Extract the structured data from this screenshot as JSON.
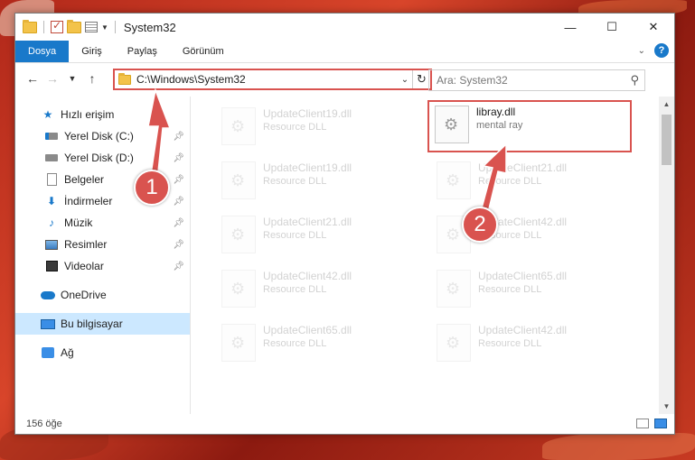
{
  "window": {
    "title": "System32"
  },
  "ribbon": {
    "tabs": [
      "Dosya",
      "Giriş",
      "Paylaş",
      "Görünüm"
    ]
  },
  "address": {
    "path": "C:\\Windows\\System32"
  },
  "search": {
    "placeholder": "Ara: System32"
  },
  "nav": {
    "items": [
      {
        "label": "Hızlı erişim",
        "icon": "star-icon"
      },
      {
        "label": "Yerel Disk (C:)",
        "icon": "drive-icon"
      },
      {
        "label": "Yerel Disk (D:)",
        "icon": "drive-icon"
      },
      {
        "label": "Belgeler",
        "icon": "document-icon"
      },
      {
        "label": "İndirmeler",
        "icon": "download-icon"
      },
      {
        "label": "Müzik",
        "icon": "music-icon"
      },
      {
        "label": "Resimler",
        "icon": "pictures-icon"
      },
      {
        "label": "Videolar",
        "icon": "video-icon"
      },
      {
        "label": "OneDrive",
        "icon": "cloud-icon"
      },
      {
        "label": "Bu bilgisayar",
        "icon": "computer-icon"
      },
      {
        "label": "Ağ",
        "icon": "network-icon"
      }
    ]
  },
  "files": [
    {
      "name": "UpdateClient19.dll",
      "type": "Resource DLL"
    },
    {
      "name": "libray.dll",
      "type": "mental ray"
    },
    {
      "name": "UpdateClient19.dll",
      "type": "Resource DLL"
    },
    {
      "name": "UpdateClient21.dll",
      "type": "Resource DLL"
    },
    {
      "name": "UpdateClient21.dll",
      "type": "Resource DLL"
    },
    {
      "name": "UpdateClient42.dll",
      "type": "Resource DLL"
    },
    {
      "name": "UpdateClient42.dll",
      "type": "Resource DLL"
    },
    {
      "name": "UpdateClient65.dll",
      "type": "Resource DLL"
    },
    {
      "name": "UpdateClient65.dll",
      "type": "Resource DLL"
    },
    {
      "name": "UpdateClient42.dll",
      "type": "Resource DLL"
    }
  ],
  "status": {
    "count": "156 öğe"
  },
  "callouts": {
    "one": "1",
    "two": "2"
  },
  "colors": {
    "accent": "#1979ca",
    "highlight": "#d9534f"
  }
}
